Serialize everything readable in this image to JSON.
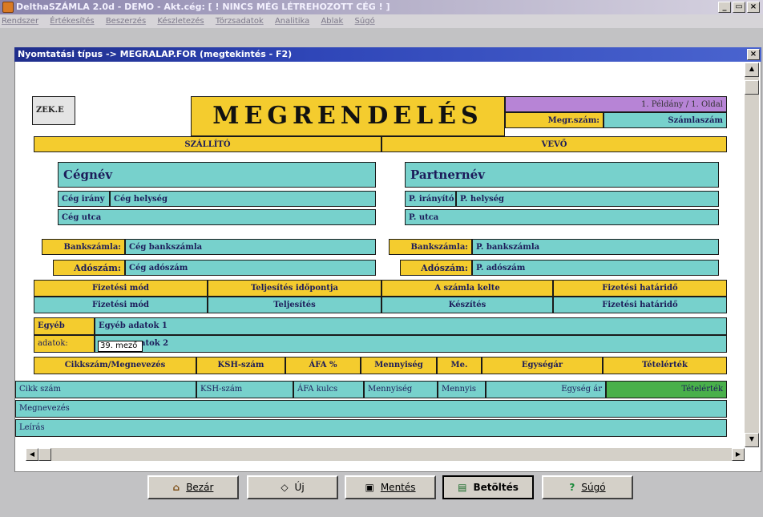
{
  "app": {
    "title": "DelthaSZÁMLA 2.0d  - DEMO -  Akt.cég: [ ! NINCS MÉG LÉTREHOZOTT CÉG ! ]",
    "win_buttons": [
      "_",
      "▭",
      "×"
    ]
  },
  "menu": [
    "Rendszer",
    "Értékesítés",
    "Beszerzés",
    "Készletezés",
    "Törzsadatok",
    "Analitika",
    "Ablak",
    "Súgó"
  ],
  "child": {
    "title": "Nyomtatási típus -> MEGRALAP.FOR  (megtekintés - F2)",
    "close": "×"
  },
  "form": {
    "logo_text": "ZEK.E",
    "title": "MEGRENDELÉS",
    "peldany": "1. Példány / 1. Oldal",
    "megr_szam": "Megr.szám:",
    "szamlaszam": "Számlaszám",
    "szallito": "SZÁLLÍTÓ",
    "vevo": "VEVŐ",
    "cegnev": "Cégnév",
    "ceg_iranyito": "Cég irány",
    "ceg_helyseg": "Cég helység",
    "ceg_utca": "Cég utca",
    "partnernev": "Partnernév",
    "p_iranyito": "P. irányító",
    "p_helyseg": "P. helység",
    "p_utca": "P. utca",
    "bankszamla_label": "Bankszámla:",
    "ceg_bankszamla": "Cég bankszámla",
    "p_bankszamla": "P. bankszámla",
    "adoszam_label": "Adószám:",
    "ceg_adoszam": "Cég adószám",
    "p_adoszam": "P. adószám",
    "hdr_fizetesi_mod": "Fizetési mód",
    "hdr_teljesites": "Teljesítés időpontja",
    "hdr_kelte": "A számla kelte",
    "hdr_hatarido": "Fizetési határidő",
    "val_fizetesi_mod": "Fizetési mód",
    "val_teljesites": "Teljesítés",
    "val_keszites": "Készítés",
    "val_hatarido": "Fizetési határidő",
    "egyeb": "Egyéb",
    "egyeb_adatok1": "Egyéb adatok 1",
    "adatok": "adatok:",
    "egyeb_adatok2": "atok 2",
    "tooltip": "39. mező",
    "col_cikkszam": "Cikkszám/Megnevezés",
    "col_ksh": "KSH-szám",
    "col_afa": "ÁFA %",
    "col_mennyiseg": "Mennyiség",
    "col_me": "Me.",
    "col_egysegar": "Egységár",
    "col_tetelertek": "Tételérték",
    "row_cikkszam": "Cikk szám",
    "row_ksh": "KSH-szám",
    "row_afa": "ÁFA kulcs",
    "row_mennyiseg": "Mennyiség",
    "row_mennyis2": "Mennyis",
    "row_egysegar": "Egység ár",
    "row_tetelertek": "Tételérték",
    "megnevezes": "Megnevezés",
    "leiras": "Leírás"
  },
  "toolbar": {
    "bezar": "Bezár",
    "uj": "Új",
    "mentes": "Mentés",
    "betoltes": "Betöltés",
    "sugo": "Súgó"
  },
  "colors": {
    "yellow": "#f4cc2e",
    "teal": "#77d1cc",
    "purple": "#b784d6",
    "green": "#49b04a",
    "title_blue": "#1f2e8c"
  }
}
